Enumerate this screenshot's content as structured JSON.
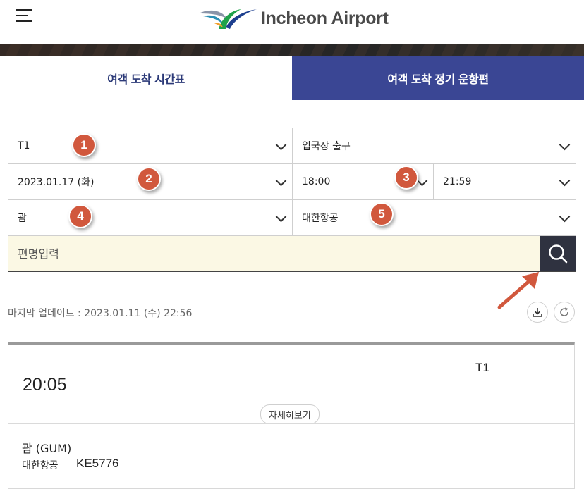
{
  "header": {
    "logo_text": "Incheon Airport",
    "menu_icon": "hamburger-menu-icon",
    "logo_icon": "incheon-airport-logo-icon"
  },
  "tabs": [
    {
      "label": "여객 도착 시간표",
      "active": true
    },
    {
      "label": "여객 도착 정기 운항편",
      "active": false
    }
  ],
  "filters": {
    "terminal": "T1",
    "exit": "입국장 출구",
    "date": "2023.01.17 (화)",
    "time_from": "18:00",
    "time_to": "21:59",
    "origin": "괌",
    "airline": "대한항공",
    "flight_placeholder": "편명입력"
  },
  "annotations": [
    "1",
    "2",
    "3",
    "4",
    "5"
  ],
  "update": {
    "label": "마지막 업데이트 : 2023.01.11 (수) 22:56"
  },
  "flight": {
    "time": "20:05",
    "terminal": "T1",
    "detail_label": "자세히보기",
    "destination": "괌 (GUM)",
    "airline": "대한항공",
    "flight_no": "KE5776"
  },
  "colors": {
    "tab_active_text": "#2c3a78",
    "tab_inactive_bg": "#3a4694",
    "badge": "#d1583d",
    "search_bg": "#fbf8e4",
    "search_button": "#2f3240"
  }
}
